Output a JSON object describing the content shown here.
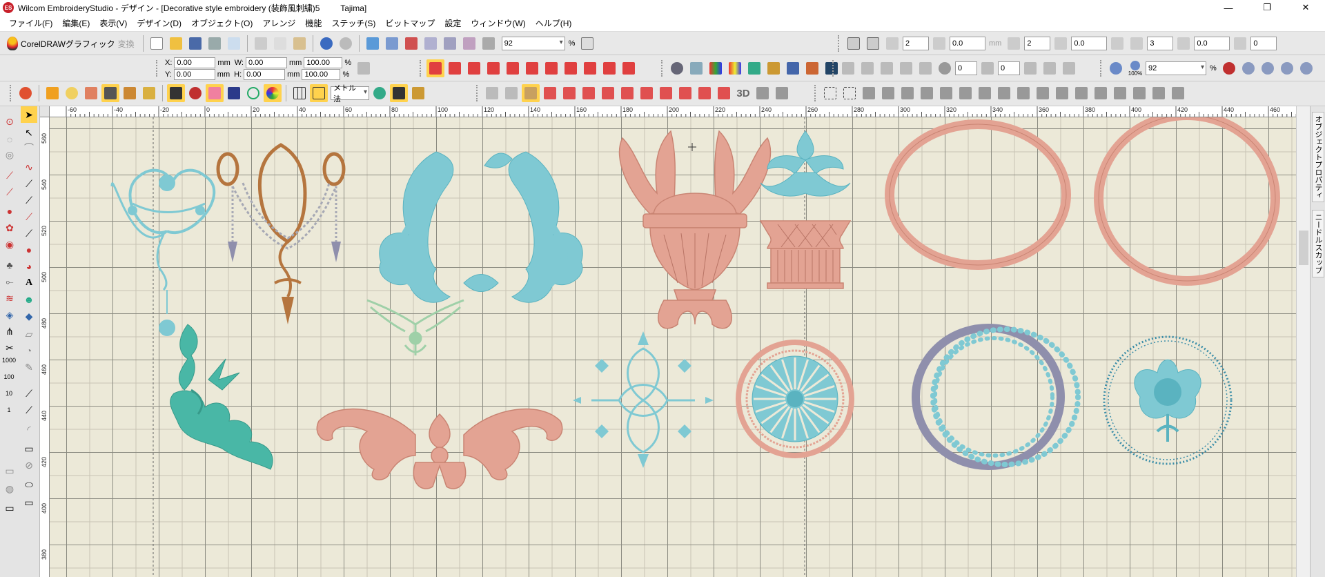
{
  "window": {
    "app_icon": "ES",
    "title": "Wilcom EmbroideryStudio - デザイン - [Decorative style embroidery (装飾風刺繍)5         Tajima]",
    "controls": [
      "—",
      "❐",
      "✕"
    ]
  },
  "menu": [
    "ファイル(F)",
    "編集(E)",
    "表示(V)",
    "デザイン(D)",
    "オブジェクト(O)",
    "アレンジ",
    "機能",
    "ステッチ(S)",
    "ビットマップ",
    "設定",
    "ウィンドウ(W)",
    "ヘルプ(H)"
  ],
  "toolbar1": {
    "coreldraw_label": "CorelDRAWグラフィック",
    "convert_label": "変換",
    "zoom_value": "92",
    "zoom_unit": "%",
    "spin_values": [
      "2",
      "0.0",
      "2",
      "0.0",
      "3",
      "0.0",
      "0"
    ],
    "mm_label": "mm"
  },
  "toolbar2": {
    "x_label": "X:",
    "x_value": "0.00",
    "y_label": "Y:",
    "y_value": "0.00",
    "w_label": "W:",
    "w_value": "0.00",
    "h_label": "H:",
    "h_value": "0.00",
    "unit": "mm",
    "scale_w": "100.00",
    "scale_h": "100.00",
    "pct": "%",
    "rotate_value": "0",
    "slant_value": "0",
    "zoom2_value": "92",
    "zoom2_unit": "%",
    "zoom_100_label": "100%"
  },
  "toolbar3": {
    "method_select": "メトル法",
    "label_3d": "3D"
  },
  "ruler": {
    "h_ticks": [
      "-60",
      "-40",
      "-20",
      "0",
      "20",
      "40",
      "60",
      "80",
      "100",
      "120",
      "140",
      "160",
      "180",
      "200",
      "220",
      "240",
      "260",
      "280",
      "300",
      "320",
      "340",
      "360",
      "380",
      "400",
      "420",
      "440",
      "460"
    ],
    "v_ticks": [
      "560",
      "540",
      "520",
      "500",
      "480",
      "460",
      "440",
      "420",
      "400",
      "380"
    ]
  },
  "toolbox": {
    "scale_labels": [
      "1000",
      "100",
      "10",
      "1"
    ]
  },
  "dockers": [
    "オブジェクトプロパティ",
    "ニードルスカップ"
  ],
  "colors": {
    "canvas_bg": "#ece9d8",
    "aqua": "#7fc9d3",
    "teal": "#49b7a6",
    "salmon": "#e3a393",
    "bronze": "#b5753e",
    "mint": "#9fd0a8",
    "lavender": "#8f8fac",
    "silver": "#a6a8b4"
  }
}
